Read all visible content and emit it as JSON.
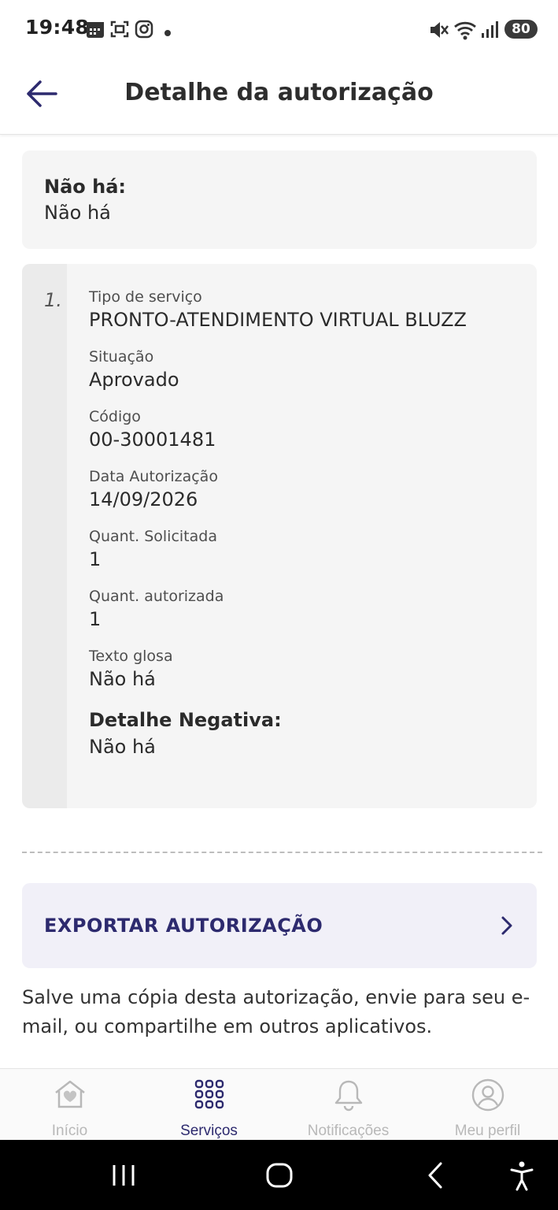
{
  "status_bar": {
    "time": "19:48",
    "battery": "80"
  },
  "header": {
    "title": "Detalhe da autorização"
  },
  "summary": {
    "label": "Não há:",
    "value": "Não há"
  },
  "item": {
    "index": "1.",
    "fields": [
      {
        "label": "Tipo de serviço",
        "value": "PRONTO-ATENDIMENTO VIRTUAL BLUZZ"
      },
      {
        "label": "Situação",
        "value": "Aprovado"
      },
      {
        "label": "Código",
        "value": "00-30001481"
      },
      {
        "label": "Data Autorização",
        "value": "14/09/2026"
      },
      {
        "label": "Quant. Solicitada",
        "value": "1"
      },
      {
        "label": "Quant. autorizada",
        "value": "1"
      },
      {
        "label": "Texto glosa",
        "value": "Não há"
      }
    ],
    "negative": {
      "label": "Detalhe Negativa:",
      "value": "Não há"
    }
  },
  "export": {
    "label": "EXPORTAR AUTORIZAÇÃO",
    "description": "Salve uma cópia desta autorização, envie para seu e-mail, ou compartilhe em outros aplicativos."
  },
  "bottom_nav": {
    "active": "Serviços",
    "items": [
      {
        "label": "Início",
        "icon": "home-heart-icon"
      },
      {
        "label": "Serviços",
        "icon": "grid-icon"
      },
      {
        "label": "Notificações",
        "icon": "bell-icon"
      },
      {
        "label": "Meu perfil",
        "icon": "user-circle-icon"
      }
    ]
  },
  "colors": {
    "accent": "#2d2a6e",
    "card_bg": "#f5f5f5",
    "index_col_bg": "#ebebeb",
    "export_bg": "#f1f0f8",
    "inactive_nav": "#b8b8b8"
  }
}
